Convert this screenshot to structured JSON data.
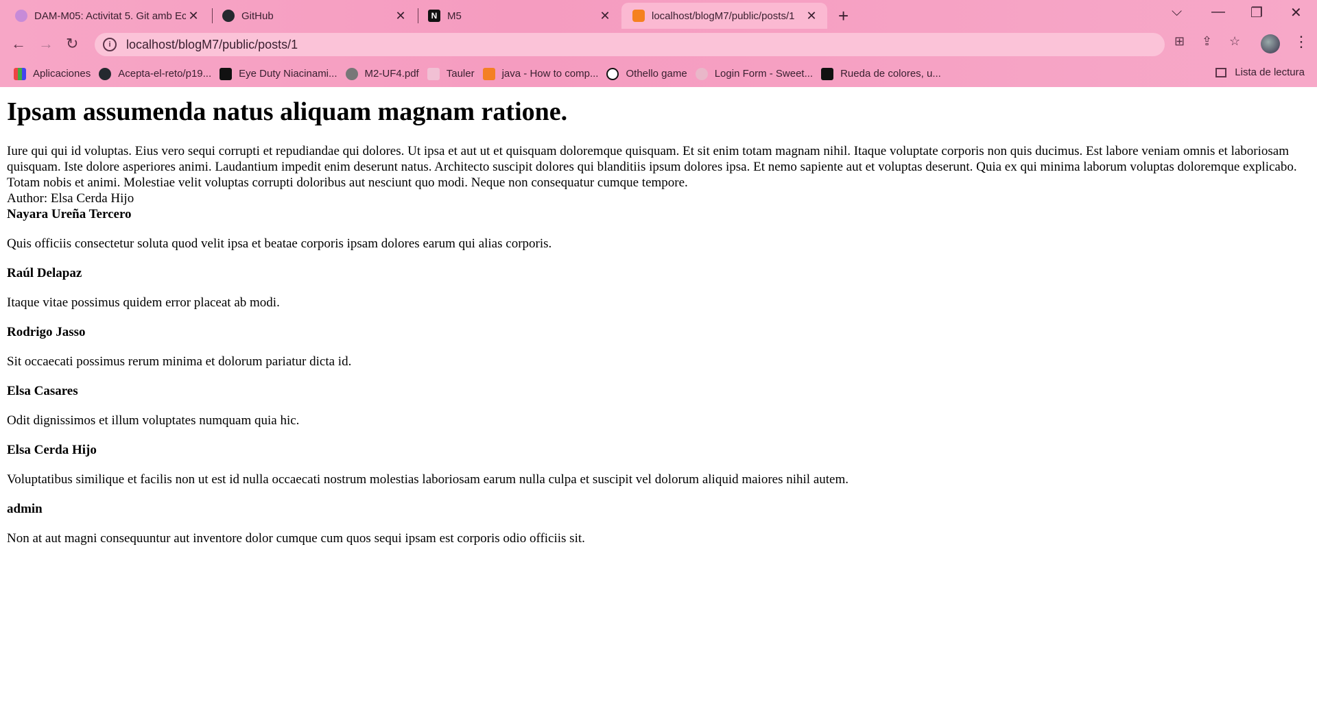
{
  "browser": {
    "tabs": [
      {
        "title": "DAM-M05: Activitat 5. Git amb Ec",
        "icon": "moodle-icon"
      },
      {
        "title": "GitHub",
        "icon": "github-icon"
      },
      {
        "title": "M5",
        "icon": "notion-icon"
      },
      {
        "title": "localhost/blogM7/public/posts/1",
        "icon": "xampp-icon",
        "active": true
      }
    ],
    "url": "localhost/blogM7/public/posts/1",
    "bookmarks": [
      {
        "label": "Aplicaciones",
        "icon": "apps-grid-icon"
      },
      {
        "label": "Acepta-el-reto/p19...",
        "icon": "github-icon"
      },
      {
        "label": "Eye Duty Niacinami...",
        "icon": "product-icon"
      },
      {
        "label": "M2-UF4.pdf",
        "icon": "globe-icon"
      },
      {
        "label": "Tauler",
        "icon": "tauler-icon"
      },
      {
        "label": "java - How to comp...",
        "icon": "stackoverflow-icon"
      },
      {
        "label": "Othello game",
        "icon": "codepen-icon"
      },
      {
        "label": "Login Form - Sweet...",
        "icon": "sweet-icon"
      },
      {
        "label": "Rueda de colores, u...",
        "icon": "canva-icon"
      }
    ],
    "reading_list": "Lista de lectura",
    "colors": {
      "chrome": "#f7a6c6",
      "active_tab": "#fbb9d2",
      "omnibox": "#fbc3d8"
    }
  },
  "post": {
    "title": "Ipsam assumenda natus aliquam magnam ratione.",
    "body": "Iure qui qui id voluptas. Eius vero sequi corrupti et repudiandae qui dolores. Ut ipsa et aut ut et quisquam doloremque quisquam. Et sit enim totam magnam nihil. Itaque voluptate corporis non quis ducimus. Est labore veniam omnis et laboriosam quisquam. Iste dolore asperiores animi. Laudantium impedit enim deserunt natus. Architecto suscipit dolores qui blanditiis ipsum dolores ipsa. Et nemo sapiente aut et voluptas deserunt. Quia ex qui minima laborum voluptas doloremque explicabo. Totam nobis et animi. Molestiae velit voluptas corrupti doloribus aut nesciunt quo modi. Neque non consequatur cumque tempore.",
    "author": "Author: Elsa Cerda Hijo"
  },
  "comments": [
    {
      "name": "Nayara Ureña Tercero",
      "text": "Quis officiis consectetur soluta quod velit ipsa et beatae corporis ipsam dolores earum qui alias corporis."
    },
    {
      "name": "Raúl Delapaz",
      "text": "Itaque vitae possimus quidem error placeat ab modi."
    },
    {
      "name": "Rodrigo Jasso",
      "text": "Sit occaecati possimus rerum minima et dolorum pariatur dicta id."
    },
    {
      "name": "Elsa Casares",
      "text": "Odit dignissimos et illum voluptates numquam quia hic."
    },
    {
      "name": "Elsa Cerda Hijo",
      "text": "Voluptatibus similique et facilis non ut est id nulla occaecati nostrum molestias laboriosam earum nulla culpa et suscipit vel dolorum aliquid maiores nihil autem."
    },
    {
      "name": "admin",
      "text": "Non at aut magni consequuntur aut inventore dolor cumque cum quos sequi ipsam est corporis odio officiis sit."
    }
  ]
}
